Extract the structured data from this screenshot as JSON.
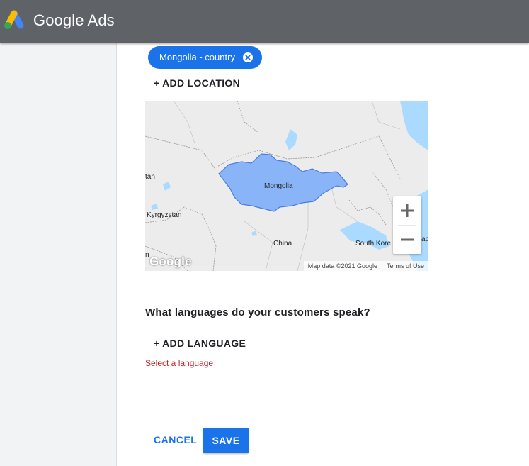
{
  "header": {
    "brand": "Google Ads",
    "logo_icon": "google-ads-logo-icon",
    "colors": {
      "bar": "#5f6368",
      "logo_blue": "#4285f4",
      "logo_yellow": "#fbbc04",
      "logo_green": "#34a853"
    }
  },
  "locations": {
    "selected_chip": {
      "label": "Mongolia - country",
      "remove_icon": "close-circle-icon"
    },
    "add_label": "+ ADD LOCATION"
  },
  "map": {
    "labels": {
      "mongolia": "Mongolia",
      "stan": "tan",
      "kyrgyzstan": "Kyrgyzstan",
      "china": "China",
      "south_korea": "South Kore",
      "jap": "ap",
      "n": "n"
    },
    "watermark": "Google",
    "attribution": "Map data ©2021 Google",
    "terms": "Terms of Use",
    "zoom_in_icon": "plus-icon",
    "zoom_out_icon": "minus-icon",
    "colors": {
      "land": "#ececec",
      "water": "#aadaff",
      "highlight": "#8ab4f8",
      "highlight_stroke": "#4a7de0"
    }
  },
  "languages": {
    "question": "What languages do your customers speak?",
    "add_label": "+ ADD LANGUAGE",
    "error": "Select a language"
  },
  "actions": {
    "cancel": "CANCEL",
    "save": "SAVE",
    "primary_color": "#1a73e8"
  }
}
